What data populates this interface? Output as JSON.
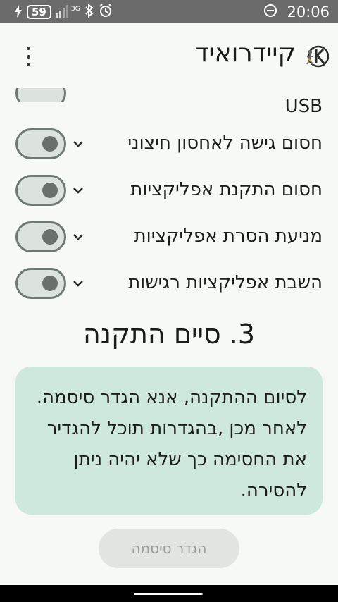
{
  "status_bar": {
    "battery": "59",
    "network": "3G",
    "time": "20:06",
    "icons": [
      "flash-icon",
      "signal-icon",
      "bluetooth-icon",
      "alarm-icon",
      "data-saver-icon"
    ]
  },
  "app_bar": {
    "title": "קיידרואיד",
    "menu_icon": "more-vert-icon",
    "logo_icon": "kiddroid-logo"
  },
  "settings": {
    "partial_label": "USB",
    "rows": [
      {
        "label": "חסום גישה לאחסון חיצוני",
        "enabled": true
      },
      {
        "label": "חסום התקנת אפליקציות",
        "enabled": true
      },
      {
        "label": "מניעת הסרת אפליקציות",
        "enabled": true
      },
      {
        "label": "השבת אפליקציות רגישות",
        "enabled": true
      }
    ]
  },
  "section": {
    "title": "3. סיים התקנה"
  },
  "card": {
    "text": "לסיום ההתקנה, אנא הגדר סיסמה. לאחר מכן ,בהגדרות תוכל להגדיר את החסימה כך שלא יהיה ניתן להסירה."
  },
  "button": {
    "label": "הגדר סיסמה"
  },
  "colors": {
    "status_bar": "#6b6b6b",
    "background": "#f7f9f5",
    "card": "#cfe8dc",
    "toggle_track": "#dce3dd",
    "toggle_knob": "#6a716b"
  }
}
